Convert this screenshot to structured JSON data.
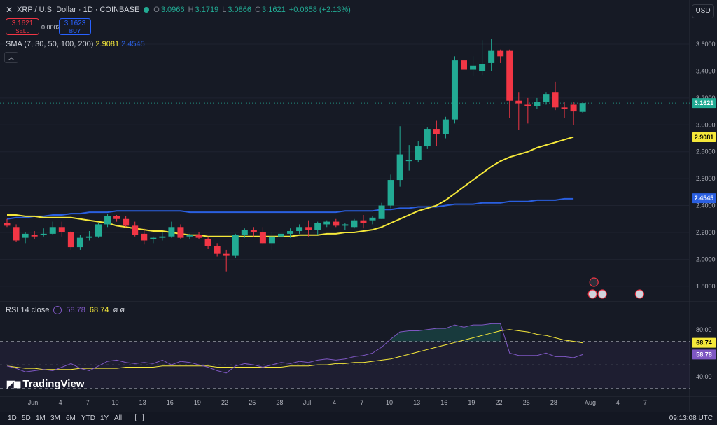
{
  "header": {
    "symbol": "XRP / U.S. Dollar · 1D · COINBASE",
    "open_label": "O",
    "open": "3.0966",
    "high_label": "H",
    "high": "3.1719",
    "low_label": "L",
    "low": "3.0866",
    "close_label": "C",
    "close": "3.1621",
    "change": "+0.0658 (+2.13%)",
    "currency": "USD"
  },
  "trade": {
    "sell_price": "3.1621",
    "sell_label": "SELL",
    "spread": "0.0002",
    "buy_price": "3.1623",
    "buy_label": "BUY"
  },
  "sma": {
    "label": "SMA (7, 30, 50, 100, 200)",
    "value1": "2.9081",
    "value2": "2.4545"
  },
  "rsi": {
    "label": "RSI 14 close",
    "value1": "58.78",
    "value2": "68.74",
    "extra": "ø ø"
  },
  "brand": "TradingView",
  "ranges": [
    "1D",
    "5D",
    "1M",
    "3M",
    "6M",
    "YTD",
    "1Y",
    "All"
  ],
  "clock": "09:13:08 UTC",
  "colors": {
    "background": "#161a25",
    "up": "#22ab94",
    "down": "#f23645",
    "sma_yellow": "#f5e83a",
    "sma_blue": "#2a5fe0",
    "rsi_purple": "#7e57c2"
  },
  "chart_data": [
    {
      "type": "candlestick",
      "title": "XRP / U.S. Dollar · 1D · COINBASE",
      "ylim": [
        1.7,
        3.72
      ],
      "y_ticks": [
        "3.6000",
        "3.4000",
        "3.2000",
        "3.0000",
        "2.8000",
        "2.6000",
        "2.4000",
        "2.2000",
        "2.0000",
        "1.8000"
      ],
      "y_tick_values": [
        3.6,
        3.4,
        3.2,
        3.0,
        2.8,
        2.6,
        2.4,
        2.2,
        2.0,
        1.8
      ],
      "x_ticks": [
        "Jun",
        "4",
        "7",
        "10",
        "13",
        "16",
        "19",
        "22",
        "25",
        "28",
        "Jul",
        "4",
        "7",
        "10",
        "13",
        "16",
        "19",
        "22",
        "25",
        "28",
        "Aug",
        "4",
        "7"
      ],
      "x_tick_days": [
        0,
        3,
        6,
        9,
        12,
        15,
        18,
        21,
        24,
        27,
        30,
        33,
        36,
        39,
        42,
        45,
        48,
        51,
        54,
        57,
        61,
        64,
        67
      ],
      "price_labels": [
        {
          "value": 3.1621,
          "text": "3.1621",
          "color": "#22ab94"
        },
        {
          "value": 2.9081,
          "text": "2.9081",
          "color": "#f5e83a"
        },
        {
          "value": 2.4545,
          "text": "2.4545",
          "color": "#2a5fe0"
        }
      ],
      "candles": [
        {
          "o": 2.27,
          "h": 2.3,
          "l": 2.24,
          "c": 2.25
        },
        {
          "o": 2.24,
          "h": 2.26,
          "l": 2.13,
          "c": 2.14
        },
        {
          "o": 2.16,
          "h": 2.2,
          "l": 2.12,
          "c": 2.19
        },
        {
          "o": 2.18,
          "h": 2.21,
          "l": 2.15,
          "c": 2.17
        },
        {
          "o": 2.18,
          "h": 2.23,
          "l": 2.17,
          "c": 2.19
        },
        {
          "o": 2.19,
          "h": 2.28,
          "l": 2.18,
          "c": 2.24
        },
        {
          "o": 2.24,
          "h": 2.28,
          "l": 2.17,
          "c": 2.2
        },
        {
          "o": 2.2,
          "h": 2.21,
          "l": 2.07,
          "c": 2.09
        },
        {
          "o": 2.09,
          "h": 2.18,
          "l": 2.07,
          "c": 2.16
        },
        {
          "o": 2.16,
          "h": 2.21,
          "l": 2.14,
          "c": 2.17
        },
        {
          "o": 2.17,
          "h": 2.27,
          "l": 2.16,
          "c": 2.26
        },
        {
          "o": 2.26,
          "h": 2.34,
          "l": 2.24,
          "c": 2.32
        },
        {
          "o": 2.32,
          "h": 2.33,
          "l": 2.28,
          "c": 2.3
        },
        {
          "o": 2.3,
          "h": 2.32,
          "l": 2.24,
          "c": 2.25
        },
        {
          "o": 2.25,
          "h": 2.28,
          "l": 2.17,
          "c": 2.18
        },
        {
          "o": 2.19,
          "h": 2.23,
          "l": 2.11,
          "c": 2.14
        },
        {
          "o": 2.15,
          "h": 2.17,
          "l": 2.12,
          "c": 2.16
        },
        {
          "o": 2.16,
          "h": 2.2,
          "l": 2.14,
          "c": 2.17
        },
        {
          "o": 2.17,
          "h": 2.28,
          "l": 2.16,
          "c": 2.24
        },
        {
          "o": 2.24,
          "h": 2.26,
          "l": 2.15,
          "c": 2.16
        },
        {
          "o": 2.17,
          "h": 2.19,
          "l": 2.15,
          "c": 2.18
        },
        {
          "o": 2.18,
          "h": 2.2,
          "l": 2.15,
          "c": 2.16
        },
        {
          "o": 2.15,
          "h": 2.17,
          "l": 2.08,
          "c": 2.1
        },
        {
          "o": 2.1,
          "h": 2.12,
          "l": 2.02,
          "c": 2.04
        },
        {
          "o": 2.04,
          "h": 2.07,
          "l": 1.91,
          "c": 2.03
        },
        {
          "o": 2.03,
          "h": 2.19,
          "l": 2.01,
          "c": 2.18
        },
        {
          "o": 2.18,
          "h": 2.23,
          "l": 2.16,
          "c": 2.22
        },
        {
          "o": 2.22,
          "h": 2.24,
          "l": 2.17,
          "c": 2.2
        },
        {
          "o": 2.2,
          "h": 2.24,
          "l": 2.11,
          "c": 2.12
        },
        {
          "o": 2.12,
          "h": 2.2,
          "l": 2.07,
          "c": 2.17
        },
        {
          "o": 2.17,
          "h": 2.2,
          "l": 2.15,
          "c": 2.19
        },
        {
          "o": 2.19,
          "h": 2.23,
          "l": 2.16,
          "c": 2.21
        },
        {
          "o": 2.21,
          "h": 2.26,
          "l": 2.19,
          "c": 2.24
        },
        {
          "o": 2.24,
          "h": 2.29,
          "l": 2.17,
          "c": 2.22
        },
        {
          "o": 2.22,
          "h": 2.28,
          "l": 2.18,
          "c": 2.27
        },
        {
          "o": 2.26,
          "h": 2.29,
          "l": 2.24,
          "c": 2.28
        },
        {
          "o": 2.28,
          "h": 2.3,
          "l": 2.24,
          "c": 2.25
        },
        {
          "o": 2.25,
          "h": 2.27,
          "l": 2.22,
          "c": 2.26
        },
        {
          "o": 2.24,
          "h": 2.3,
          "l": 2.23,
          "c": 2.29
        },
        {
          "o": 2.29,
          "h": 2.33,
          "l": 2.23,
          "c": 2.27
        },
        {
          "o": 2.29,
          "h": 2.32,
          "l": 2.26,
          "c": 2.31
        },
        {
          "o": 2.3,
          "h": 2.42,
          "l": 2.3,
          "c": 2.4
        },
        {
          "o": 2.4,
          "h": 2.63,
          "l": 2.38,
          "c": 2.59
        },
        {
          "o": 2.59,
          "h": 2.99,
          "l": 2.54,
          "c": 2.78
        },
        {
          "o": 2.73,
          "h": 2.85,
          "l": 2.66,
          "c": 2.74
        },
        {
          "o": 2.74,
          "h": 2.88,
          "l": 2.72,
          "c": 2.84
        },
        {
          "o": 2.84,
          "h": 2.98,
          "l": 2.82,
          "c": 2.97
        },
        {
          "o": 2.97,
          "h": 3.03,
          "l": 2.84,
          "c": 2.93
        },
        {
          "o": 2.93,
          "h": 3.06,
          "l": 2.9,
          "c": 3.04
        },
        {
          "o": 3.04,
          "h": 3.51,
          "l": 3.01,
          "c": 3.48
        },
        {
          "o": 3.48,
          "h": 3.65,
          "l": 3.35,
          "c": 3.41
        },
        {
          "o": 3.41,
          "h": 3.51,
          "l": 3.36,
          "c": 3.44
        },
        {
          "o": 3.4,
          "h": 3.63,
          "l": 3.37,
          "c": 3.45
        },
        {
          "o": 3.46,
          "h": 3.64,
          "l": 3.4,
          "c": 3.55
        },
        {
          "o": 3.55,
          "h": 3.56,
          "l": 3.46,
          "c": 3.51
        },
        {
          "o": 3.55,
          "h": 3.56,
          "l": 3.05,
          "c": 3.18
        },
        {
          "o": 3.18,
          "h": 3.24,
          "l": 2.96,
          "c": 3.16
        },
        {
          "o": 3.15,
          "h": 3.2,
          "l": 3.01,
          "c": 3.14
        },
        {
          "o": 3.14,
          "h": 3.2,
          "l": 3.12,
          "c": 3.17
        },
        {
          "o": 3.17,
          "h": 3.24,
          "l": 3.15,
          "c": 3.23
        },
        {
          "o": 3.24,
          "h": 3.32,
          "l": 3.11,
          "c": 3.13
        },
        {
          "o": 3.13,
          "h": 3.17,
          "l": 3.05,
          "c": 3.12
        },
        {
          "o": 3.15,
          "h": 3.17,
          "l": 3.0,
          "c": 3.1
        },
        {
          "o": 3.0966,
          "h": 3.1719,
          "l": 3.0866,
          "c": 3.1621
        }
      ],
      "sma_yellow": [
        2.33,
        2.33,
        2.32,
        2.32,
        2.31,
        2.31,
        2.31,
        2.31,
        2.3,
        2.29,
        2.28,
        2.27,
        2.25,
        2.24,
        2.23,
        2.22,
        2.21,
        2.21,
        2.2,
        2.19,
        2.18,
        2.18,
        2.17,
        2.17,
        2.17,
        2.17,
        2.17,
        2.17,
        2.17,
        2.17,
        2.17,
        2.17,
        2.18,
        2.18,
        2.18,
        2.19,
        2.19,
        2.2,
        2.2,
        2.21,
        2.22,
        2.24,
        2.27,
        2.3,
        2.33,
        2.36,
        2.38,
        2.4,
        2.44,
        2.49,
        2.54,
        2.59,
        2.64,
        2.69,
        2.73,
        2.76,
        2.78,
        2.8,
        2.83,
        2.85,
        2.87,
        2.89,
        2.91
      ],
      "sma_blue": [
        2.3,
        2.31,
        2.31,
        2.32,
        2.32,
        2.33,
        2.33,
        2.34,
        2.34,
        2.35,
        2.35,
        2.35,
        2.36,
        2.36,
        2.36,
        2.36,
        2.36,
        2.36,
        2.36,
        2.36,
        2.35,
        2.35,
        2.35,
        2.35,
        2.35,
        2.35,
        2.35,
        2.35,
        2.35,
        2.35,
        2.35,
        2.35,
        2.35,
        2.35,
        2.35,
        2.35,
        2.35,
        2.36,
        2.36,
        2.36,
        2.36,
        2.37,
        2.37,
        2.38,
        2.38,
        2.39,
        2.39,
        2.39,
        2.4,
        2.41,
        2.41,
        2.41,
        2.42,
        2.42,
        2.42,
        2.43,
        2.43,
        2.43,
        2.44,
        2.44,
        2.44,
        2.45,
        2.45
      ]
    },
    {
      "type": "line",
      "title": "RSI 14 close",
      "ylim": [
        28,
        90
      ],
      "y_ticks": [
        "80.00",
        "40.00"
      ],
      "y_tick_values": [
        80,
        40
      ],
      "bands": [
        70,
        50,
        30
      ],
      "price_labels": [
        {
          "value": 68.74,
          "text": "68.74",
          "color": "#f5e83a"
        },
        {
          "value": 58.78,
          "text": "58.78",
          "color": "#7e57c2"
        }
      ],
      "rsi": [
        49,
        47,
        44,
        45,
        46,
        45,
        48,
        51,
        47,
        45,
        49,
        53,
        54,
        52,
        51,
        52,
        51,
        54,
        50,
        53,
        52,
        50,
        48,
        45,
        43,
        49,
        51,
        50,
        48,
        50,
        52,
        51,
        53,
        52,
        54,
        55,
        54,
        55,
        57,
        58,
        60,
        65,
        72,
        78,
        79,
        79,
        80,
        81,
        81,
        84,
        82,
        84,
        84,
        85,
        85,
        60,
        58,
        58,
        58,
        60,
        57,
        57,
        56,
        58.78
      ],
      "rsi_ma": [
        49,
        48,
        47,
        47,
        46,
        46,
        46,
        46,
        47,
        47,
        47,
        47,
        47,
        48,
        48,
        48,
        48,
        49,
        49,
        49,
        49,
        49,
        49,
        48,
        48,
        48,
        48,
        48,
        48,
        48,
        48,
        49,
        49,
        49,
        50,
        50,
        51,
        51,
        52,
        52,
        53,
        54,
        55,
        57,
        59,
        61,
        63,
        65,
        67,
        69,
        71,
        73,
        75,
        77,
        79,
        80,
        79,
        78,
        76,
        75,
        73,
        71,
        70,
        68.74
      ]
    }
  ]
}
